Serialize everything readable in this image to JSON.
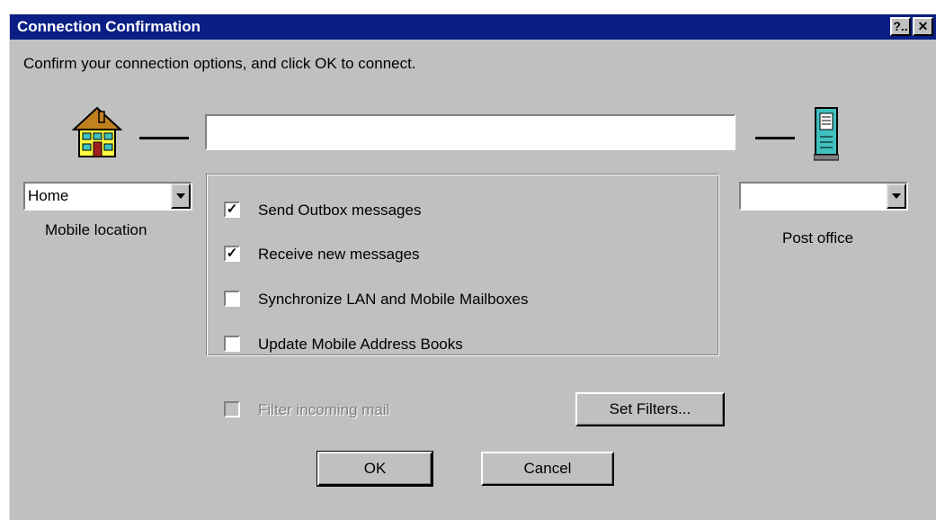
{
  "window": {
    "title": "Connection Confirmation",
    "help_button": "?..",
    "close_button": "✕"
  },
  "instructions": "Confirm your connection options, and click OK to connect.",
  "connection_field": {
    "value": ""
  },
  "mobile_location": {
    "selected": "Home",
    "label": "Mobile location"
  },
  "post_office": {
    "selected": "",
    "label": "Post office"
  },
  "options": [
    {
      "label": "Send Outbox messages",
      "checked": true
    },
    {
      "label": "Receive new messages",
      "checked": true
    },
    {
      "label": "Synchronize LAN and Mobile Mailboxes",
      "checked": false
    },
    {
      "label": "Update Mobile Address Books",
      "checked": false
    }
  ],
  "filter": {
    "label": "Filter incoming mail",
    "checked": false,
    "enabled": false
  },
  "buttons": {
    "set_filters": "Set Filters...",
    "ok": "OK",
    "cancel": "Cancel"
  },
  "icons": {
    "location": "house-icon",
    "post_office": "server-icon"
  },
  "colors": {
    "titlebar": "#0a1f86",
    "face": "#c0c0c0"
  }
}
